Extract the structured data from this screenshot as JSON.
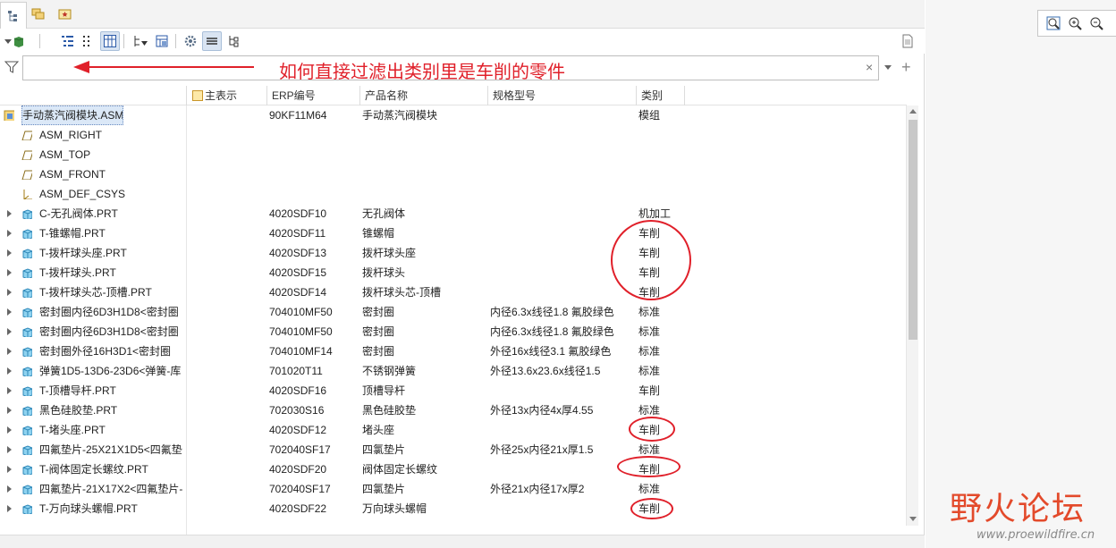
{
  "annotation": "如何直接过滤出类别里是车削的零件",
  "filter": {
    "value": ""
  },
  "columns": {
    "main_display": "主表示",
    "erp": "ERP编号",
    "name": "产品名称",
    "spec": "规格型号",
    "category": "类别"
  },
  "rows": [
    {
      "label": "手动蒸汽阀模块.ASM",
      "erp": "90KF11M64",
      "name": "手动蒸汽阀模块",
      "spec": "",
      "cat": "模组"
    },
    {
      "label": "ASM_RIGHT",
      "erp": "",
      "name": "",
      "spec": "",
      "cat": ""
    },
    {
      "label": "ASM_TOP",
      "erp": "",
      "name": "",
      "spec": "",
      "cat": ""
    },
    {
      "label": "ASM_FRONT",
      "erp": "",
      "name": "",
      "spec": "",
      "cat": ""
    },
    {
      "label": "ASM_DEF_CSYS",
      "erp": "",
      "name": "",
      "spec": "",
      "cat": ""
    },
    {
      "label": "C-无孔阀体.PRT",
      "erp": "4020SDF10",
      "name": "无孔阀体",
      "spec": "",
      "cat": "机加工"
    },
    {
      "label": "T-锥螺帽.PRT",
      "erp": "4020SDF11",
      "name": "锥螺帽",
      "spec": "",
      "cat": "车削"
    },
    {
      "label": "T-拨杆球头座.PRT",
      "erp": "4020SDF13",
      "name": "拨杆球头座",
      "spec": "",
      "cat": "车削"
    },
    {
      "label": "T-拨杆球头.PRT",
      "erp": "4020SDF15",
      "name": "拨杆球头",
      "spec": "",
      "cat": "车削"
    },
    {
      "label": "T-拨杆球头芯-顶槽.PRT",
      "erp": "4020SDF14",
      "name": "拨杆球头芯-顶槽",
      "spec": "",
      "cat": "车削"
    },
    {
      "label": "密封圈内径6D3H1D8<密封圈",
      "erp": "704010MF50",
      "name": "密封圈",
      "spec": "内径6.3x线径1.8 氟胶绿色",
      "cat": "标准"
    },
    {
      "label": "密封圈内径6D3H1D8<密封圈",
      "erp": "704010MF50",
      "name": "密封圈",
      "spec": "内径6.3x线径1.8 氟胶绿色",
      "cat": "标准"
    },
    {
      "label": "密封圈外径16H3D1<密封圈",
      "erp": "704010MF14",
      "name": "密封圈",
      "spec": "外径16x线径3.1  氟胶绿色",
      "cat": "标准"
    },
    {
      "label": "弹簧1D5-13D6-23D6<弹簧-库",
      "erp": "701020T11",
      "name": "不锈钢弹簧",
      "spec": "外径13.6x23.6x线径1.5",
      "cat": "标准"
    },
    {
      "label": "T-顶槽导杆.PRT",
      "erp": "4020SDF16",
      "name": "顶槽导杆",
      "spec": "",
      "cat": "车削"
    },
    {
      "label": "黑色硅胶垫.PRT",
      "erp": "702030S16",
      "name": "黑色硅胶垫",
      "spec": "外径13x内径4x厚4.55",
      "cat": "标准"
    },
    {
      "label": "T-堵头座.PRT",
      "erp": "4020SDF12",
      "name": "堵头座",
      "spec": "",
      "cat": "车削"
    },
    {
      "label": "四氟垫片-25X21X1D5<四氟垫",
      "erp": "702040SF17",
      "name": "四氯垫片",
      "spec": "外径25x内径21x厚1.5",
      "cat": "标准"
    },
    {
      "label": "T-阀体固定长螺纹.PRT",
      "erp": "4020SDF20",
      "name": "阀体固定长螺纹",
      "spec": "",
      "cat": "车削"
    },
    {
      "label": "四氟垫片-21X17X2<四氟垫片-",
      "erp": "702040SF17",
      "name": "四氯垫片",
      "spec": "外径21x内径17x厚2",
      "cat": "标准"
    },
    {
      "label": "T-万向球头螺帽.PRT",
      "erp": "4020SDF22",
      "name": "万向球头螺帽",
      "spec": "",
      "cat": "车削"
    }
  ],
  "watermark": {
    "title": "野火论坛",
    "url": "www.proewildfire.cn"
  }
}
